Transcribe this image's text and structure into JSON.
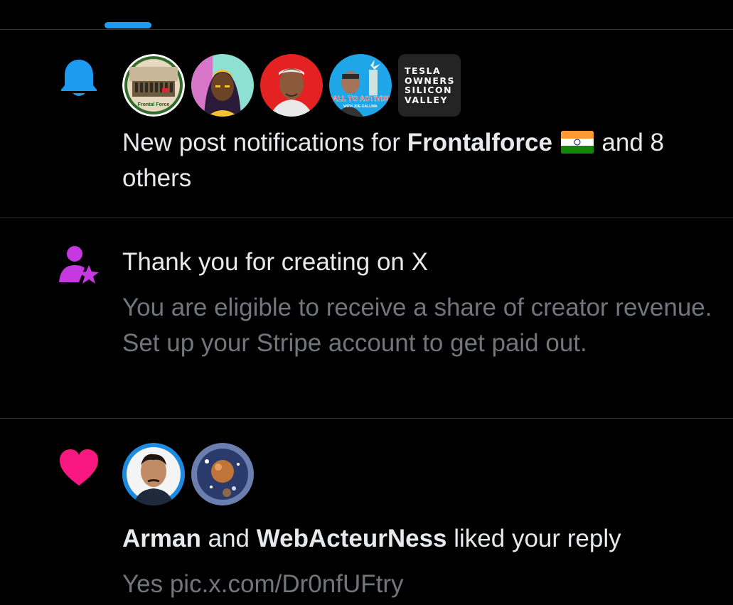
{
  "colors": {
    "background": "#000000",
    "primary_text": "#e7e9ea",
    "secondary_text": "#71767b",
    "divider": "#2f3336",
    "accent_blue": "#1d9bf0",
    "creator_purple": "#c638e0",
    "like_pink": "#f91880"
  },
  "notifications": [
    {
      "icon": "bell-icon",
      "avatars": [
        "Frontalforce",
        "warrior-woman",
        "man-with-cap",
        "Call to Activism",
        "Tesla Owners Silicon Valley"
      ],
      "avatar_caption_frontal": "Frontal Force",
      "avatar_caption_activism_1": "CALL TO ACTIVISM",
      "avatar_caption_activism_2": "WITH JOE GALLINA",
      "tesla_lines": [
        "TESLA",
        "OWNERS",
        "SILICON",
        "VALLEY"
      ],
      "text_prefix": "New post notifications for ",
      "text_name": "Frontalforce",
      "flag": "india-flag",
      "text_suffix": " and 8 others"
    },
    {
      "icon": "creator-star-person-icon",
      "title": "Thank you for creating on X",
      "body": "You are eligible to receive a share of creator revenue. Set up your Stripe account to get paid out."
    },
    {
      "icon": "heart-icon",
      "avatars": [
        "Arman",
        "WebActeurNess"
      ],
      "name1": "Arman",
      "connector": " and ",
      "name2": "WebActeurNess",
      "action": " liked your reply",
      "preview": "Yes pic.x.com/Dr0nfUFtry"
    }
  ]
}
